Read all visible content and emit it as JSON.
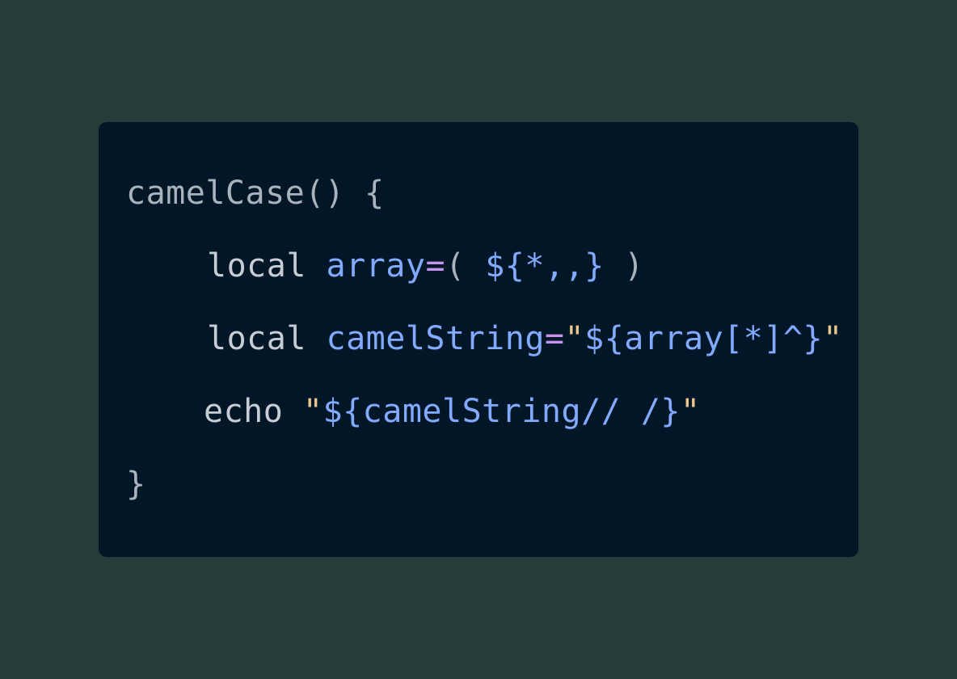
{
  "colors": {
    "page_background": "#243d3a",
    "editor_background": "#011627",
    "default_text": "#a9b2bd",
    "keyword": "#c8ccd4",
    "variable": "#82aaff",
    "operator": "#c792ea",
    "string": "#ecc48d"
  },
  "code": {
    "language": "bash",
    "lines": [
      {
        "tokens": [
          {
            "text": "camelCase",
            "color": "#a9b2bd"
          },
          {
            "text": "() {",
            "color": "#a9b2bd"
          }
        ]
      },
      {
        "tokens": [
          {
            "text": "local",
            "color": "#c8ccd4"
          },
          {
            "text": " ",
            "color": "#a9b2bd"
          },
          {
            "text": "array",
            "color": "#82aaff"
          },
          {
            "text": "=",
            "color": "#c792ea"
          },
          {
            "text": "( ",
            "color": "#a9b2bd"
          },
          {
            "text": "${*,,}",
            "color": "#82aaff"
          },
          {
            "text": " )",
            "color": "#a9b2bd"
          }
        ]
      },
      {
        "tokens": [
          {
            "text": "local",
            "color": "#c8ccd4"
          },
          {
            "text": " ",
            "color": "#a9b2bd"
          },
          {
            "text": "camelString",
            "color": "#82aaff"
          },
          {
            "text": "=",
            "color": "#c792ea"
          },
          {
            "text": "\"",
            "color": "#ecc48d"
          },
          {
            "text": "${array[*]^}",
            "color": "#82aaff"
          },
          {
            "text": "\"",
            "color": "#ecc48d"
          }
        ]
      },
      {
        "tokens": [
          {
            "text": "echo",
            "color": "#c8ccd4"
          },
          {
            "text": " ",
            "color": "#a9b2bd"
          },
          {
            "text": "\"",
            "color": "#ecc48d"
          },
          {
            "text": "${camelString// /}",
            "color": "#82aaff"
          },
          {
            "text": "\"",
            "color": "#ecc48d"
          }
        ]
      },
      {
        "tokens": [
          {
            "text": "}",
            "color": "#a9b2bd"
          }
        ]
      }
    ]
  }
}
